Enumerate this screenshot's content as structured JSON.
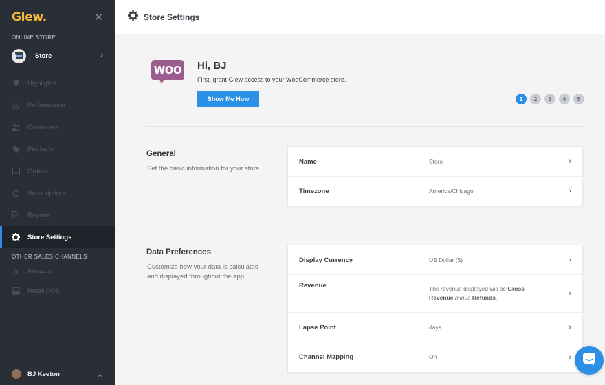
{
  "app": {
    "logo": "Glew.",
    "close_icon": "close-icon"
  },
  "sidebar": {
    "online_store_label": "ONLINE STORE",
    "store": {
      "label": "Store",
      "icon": "storefront-icon"
    },
    "items": [
      {
        "label": "Highlights",
        "icon": "trophy-icon"
      },
      {
        "label": "Performance",
        "icon": "bar-chart-icon"
      },
      {
        "label": "Customers",
        "icon": "users-icon"
      },
      {
        "label": "Products",
        "icon": "tag-icon"
      },
      {
        "label": "Orders",
        "icon": "inbox-icon"
      },
      {
        "label": "Subscriptions",
        "icon": "refresh-icon"
      },
      {
        "label": "Reports",
        "icon": "document-icon"
      },
      {
        "label": "Store Settings",
        "icon": "gear-icon",
        "active": true
      }
    ],
    "other_channels_label": "OTHER SALES CHANNELS",
    "channels": [
      {
        "label": "Amazon",
        "icon": "amazon-icon"
      },
      {
        "label": "Retail POS",
        "icon": "pos-icon"
      }
    ],
    "user": {
      "name": "BJ Keeton"
    }
  },
  "topbar": {
    "title": "Store Settings"
  },
  "hero": {
    "logo_text": "WOO",
    "greeting": "Hi, BJ",
    "message": "First, grant Glew access to your WooCommerce store.",
    "button": "Show Me How",
    "steps": [
      "1",
      "2",
      "3",
      "4",
      "5"
    ],
    "active_step": 1
  },
  "general": {
    "title": "General",
    "description": "Set the basic information for your store.",
    "rows": [
      {
        "label": "Name",
        "value": "Store"
      },
      {
        "label": "Timezone",
        "value": "America/Chicago"
      }
    ]
  },
  "data_preferences": {
    "title": "Data Preferences",
    "description": "Customize how your data is calculated and displayed throughout the app.",
    "rows": [
      {
        "label": "Display Currency",
        "value": "US Dollar ($)"
      },
      {
        "label": "Revenue",
        "value_parts": {
          "pre": "The revenue displayed will be ",
          "b1": "Gross Revenue",
          "mid": "minus",
          "b2": "Refunds",
          "post": "."
        }
      },
      {
        "label": "Lapse Point",
        "value": "days"
      },
      {
        "label": "Channel Mapping",
        "value": "On"
      }
    ]
  },
  "colors": {
    "sidebar_bg": "#2a2f37",
    "accent": "#2b90e6",
    "logo": "#f6b93b",
    "woo": "#9b5c8f"
  }
}
